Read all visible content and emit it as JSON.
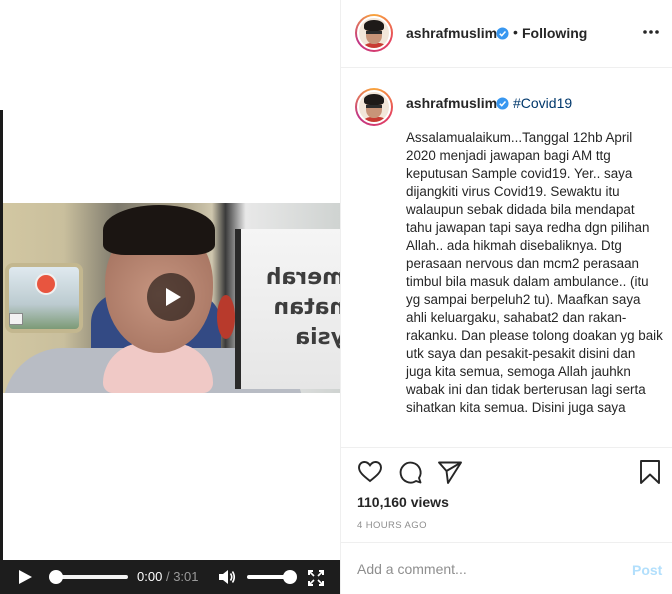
{
  "media": {
    "video_overlay_text": "merah\nnatan\nysia",
    "player": {
      "current_time": "0:00",
      "separator": "/",
      "duration": "3:01",
      "progress": 0.0,
      "volume": 1.0
    }
  },
  "post": {
    "author": {
      "username": "ashrafmuslim",
      "verified": true,
      "follow_status": "Following",
      "separator": "•"
    },
    "caption": {
      "username": "ashrafmuslim",
      "hashtag": "#Covid19",
      "text": "Assalamualaikum...Tanggal 12hb April 2020 menjadi jawapan bagi AM ttg keputusan Sample covid19. Yer.. saya dijangkiti virus Covid19. Sewaktu itu walaupun sebak didada bila mendapat tahu jawapan tapi saya redha dgn pilihan Allah.. ada hikmah disebaliknya. Dtg perasaan nervous dan mcm2 perasaan timbul bila masuk dalam ambulance.. (itu yg sampai berpeluh2 tu). Maafkan saya ahli keluargaku, sahabat2 dan rakan-rakanku. Dan please tolong doakan yg baik utk saya dan pesakit-pesakit disini dan juga kita semua, semoga Allah jauhkn wabak ini dan tidak berterusan lagi serta sihatkan kita semua. Disini juga saya"
    },
    "views": "110,160 views",
    "timestamp": "4 HOURS AGO",
    "comment": {
      "placeholder": "Add a comment...",
      "post_label": "Post"
    }
  },
  "icons": {
    "play": "play-icon",
    "volume": "volume-icon",
    "fullscreen": "fullscreen-icon",
    "more": "more-options-icon",
    "like": "heart-icon",
    "comment": "comment-icon",
    "share": "paper-plane-icon",
    "save": "bookmark-icon",
    "verified": "verified-badge-icon"
  },
  "colors": {
    "verified_badge": "#3897f0",
    "hashtag": "#00376b",
    "post_button_disabled": "#b2dffc",
    "muted_text": "#8e8e8e",
    "control_bar": "#1d1d1d"
  }
}
